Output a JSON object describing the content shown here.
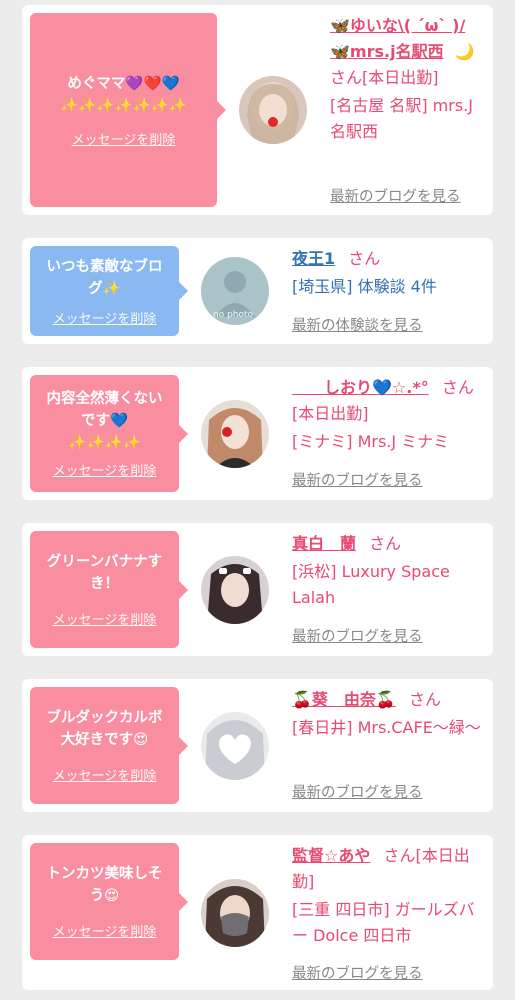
{
  "delete_label": "メッセージを削除",
  "colors": {
    "pink": "#f98ea0",
    "blue": "#8ab8f1",
    "name_pink": "#e84a72",
    "name_blue": "#3472b4"
  },
  "entries": [
    {
      "message_line1": "めぐママ💜❤️💙",
      "message_line2": "✨✨✨✨✨✨✨",
      "name": "🦋ゆいな\\( ´ω` )/🦋mrs.j名駅西",
      "suffix": "🌙 さん[本日出勤]",
      "detail": "[名古屋 名駅] mrs.J 名駅西",
      "link": "最新のブログを見る"
    },
    {
      "message_line1": "いつも素敵なブロ",
      "message_line2": "グ✨",
      "name": "夜王1",
      "suffix": "さん",
      "detail": "[埼玉県] 体験談 4件",
      "link": "最新の体験談を見る",
      "avatar_text": "no photo"
    },
    {
      "message_line1": "内容全然薄くない",
      "message_line2": "です💙",
      "message_line3": "✨✨✨✨",
      "name": "　　しおり💙☆.*°",
      "suffix": "さん[本日出勤]",
      "detail": "[ミナミ] Mrs.J ミナミ",
      "link": "最新のブログを見る"
    },
    {
      "message_line1": "グリーンバナナす",
      "message_line2": "き！",
      "name": "真白　蘭",
      "suffix": "さん",
      "detail": "[浜松] Luxury Space Lalah",
      "link": "最新のブログを見る"
    },
    {
      "message_line1": "ブルダックカルボ",
      "message_line2": "大好きです😍",
      "name": "🍒葵　由奈🍒",
      "suffix": "さん",
      "detail": "[春日井] Mrs.CAFE〜緑〜",
      "link": "最新のブログを見る"
    },
    {
      "message_line1": "トンカツ美味しそ",
      "message_line2": "う😍",
      "name": "監督☆あや",
      "suffix": "さん[本日出勤]",
      "detail": "[三重 四日市] ガールズバー Dolce 四日市",
      "link": "最新のブログを見る"
    }
  ]
}
